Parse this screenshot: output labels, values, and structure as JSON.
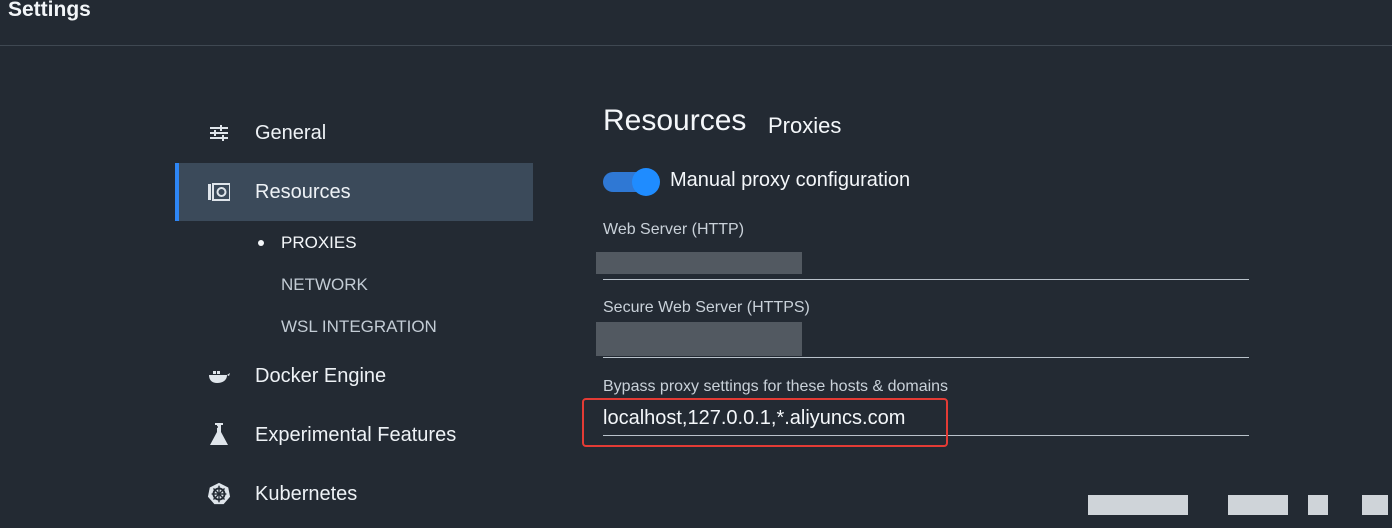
{
  "window": {
    "title": "Settings"
  },
  "sidebar": {
    "items": [
      {
        "label": "General",
        "icon": "sliders-icon"
      },
      {
        "label": "Resources",
        "icon": "camera-icon",
        "active": true
      },
      {
        "label": "Docker Engine",
        "icon": "whale-icon"
      },
      {
        "label": "Experimental Features",
        "icon": "flask-icon"
      },
      {
        "label": "Kubernetes",
        "icon": "helm-icon"
      }
    ],
    "sub_items": [
      {
        "label": "PROXIES",
        "current": true
      },
      {
        "label": "NETWORK"
      },
      {
        "label": "WSL INTEGRATION"
      }
    ]
  },
  "main": {
    "heading": "Resources",
    "subheading": "Proxies",
    "manual_proxy": {
      "label": "Manual proxy configuration",
      "enabled": true
    },
    "fields": {
      "http": {
        "label": "Web Server (HTTP)",
        "value": ""
      },
      "https": {
        "label": "Secure Web Server (HTTPS)",
        "value": ""
      },
      "bypass": {
        "label": "Bypass proxy settings for these hosts & domains",
        "value": "localhost,127.0.0.1,*.aliyuncs.com"
      }
    }
  },
  "colors": {
    "background": "#232a33",
    "active_item": "#3b4a5a",
    "accent": "#2e86f5",
    "highlight": "#e33b35"
  }
}
